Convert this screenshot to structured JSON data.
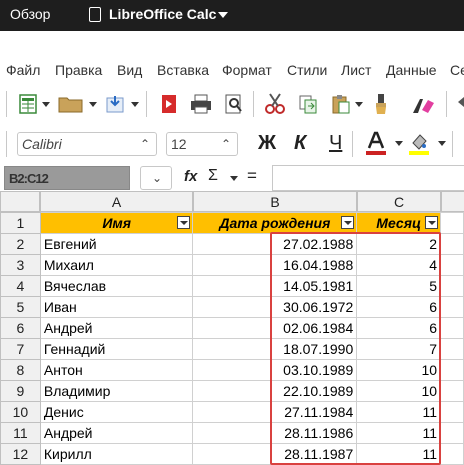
{
  "topbar": {
    "overview": "Обзор",
    "app": "LibreOffice Calc"
  },
  "menu": [
    "Файл",
    "Правка",
    "Вид",
    "Вставка",
    "Формат",
    "Стили",
    "Лист",
    "Данные",
    "Се"
  ],
  "font": {
    "name": "Calibri",
    "size": "12"
  },
  "format_buttons": {
    "bold": "Ж",
    "italic": "К",
    "underline": "Ч"
  },
  "colors": {
    "font_color": "#cc2222",
    "highlight": "#ffff00",
    "header_fill": "#ffbf00",
    "selection": "#d9413f"
  },
  "namebox": {
    "value": "B2:C12"
  },
  "formula_bar": {
    "fx": "fx",
    "sigma": "Σ",
    "equals": "=",
    "value": ""
  },
  "columns": [
    "A",
    "B",
    "C"
  ],
  "headers": [
    "Имя",
    "Дата рождения",
    "Месяц"
  ],
  "rows": [
    {
      "num": "1"
    },
    {
      "num": "2",
      "name": "Евгений",
      "date": "27.02.1988",
      "month": "2"
    },
    {
      "num": "3",
      "name": "Михаил",
      "date": "16.04.1988",
      "month": "4"
    },
    {
      "num": "4",
      "name": "Вячеслав",
      "date": "14.05.1981",
      "month": "5"
    },
    {
      "num": "5",
      "name": "Иван",
      "date": "30.06.1972",
      "month": "6"
    },
    {
      "num": "6",
      "name": "Андрей",
      "date": "02.06.1984",
      "month": "6"
    },
    {
      "num": "7",
      "name": "Геннадий",
      "date": "18.07.1990",
      "month": "7"
    },
    {
      "num": "8",
      "name": "Антон",
      "date": "03.10.1989",
      "month": "10"
    },
    {
      "num": "9",
      "name": "Владимир",
      "date": "22.10.1989",
      "month": "10"
    },
    {
      "num": "10",
      "name": "Денис",
      "date": "27.11.1984",
      "month": "11"
    },
    {
      "num": "11",
      "name": "Андрей",
      "date": "28.11.1986",
      "month": "11"
    },
    {
      "num": "12",
      "name": "Кирилл",
      "date": "28.11.1987",
      "month": "11"
    }
  ]
}
